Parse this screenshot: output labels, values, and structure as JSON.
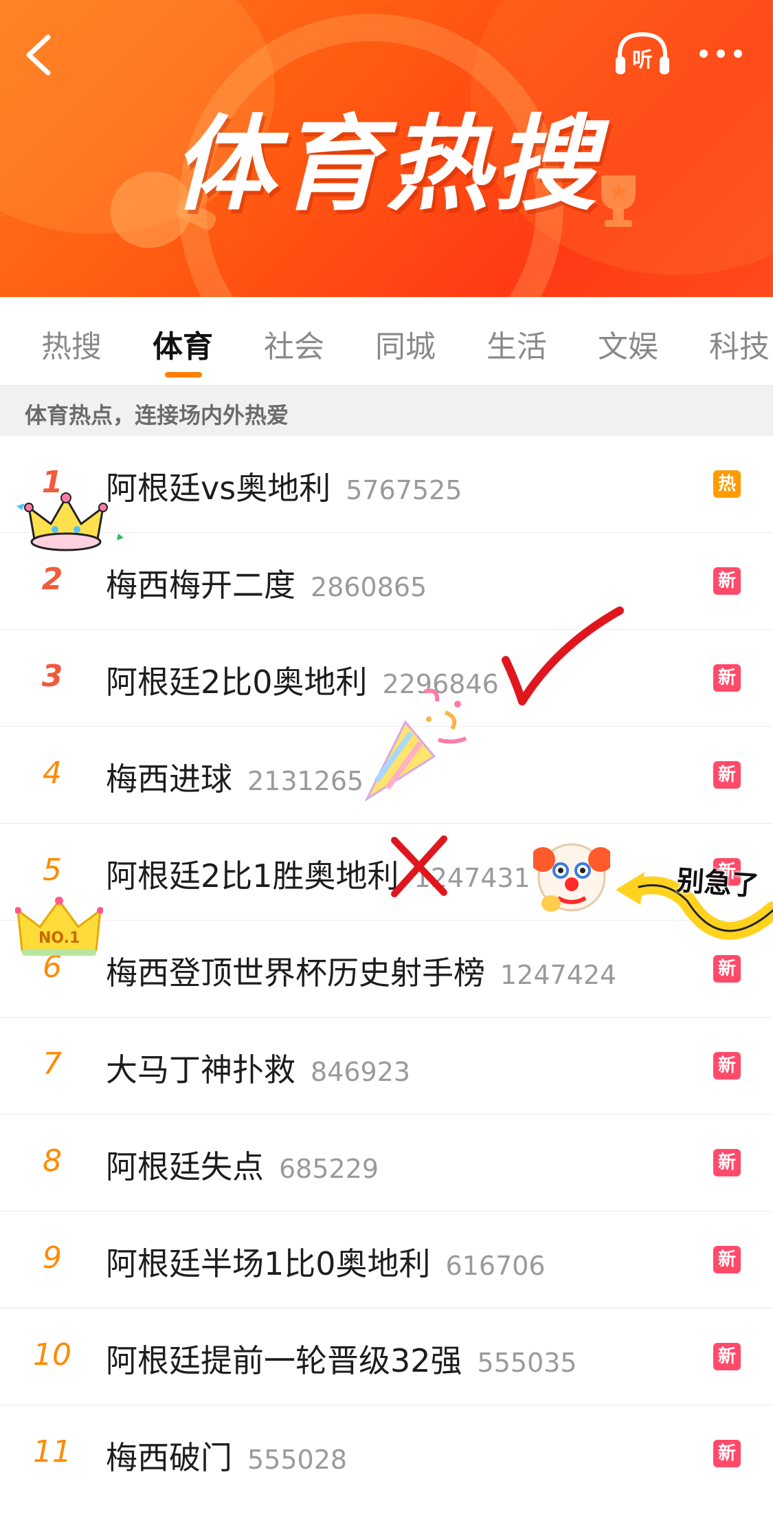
{
  "banner": {
    "title": "体育热搜",
    "listen_label": "听"
  },
  "tabs": [
    {
      "label": "热搜",
      "active": false
    },
    {
      "label": "体育",
      "active": true
    },
    {
      "label": "社会",
      "active": false
    },
    {
      "label": "同城",
      "active": false
    },
    {
      "label": "生活",
      "active": false
    },
    {
      "label": "文娱",
      "active": false
    },
    {
      "label": "科技",
      "active": false
    }
  ],
  "subheader": "体育热点，连接场内外热爱",
  "items": [
    {
      "rank": "1",
      "title": "阿根廷vs奥地利",
      "count": "5767525",
      "badge": "热"
    },
    {
      "rank": "2",
      "title": "梅西梅开二度",
      "count": "2860865",
      "badge": "新"
    },
    {
      "rank": "3",
      "title": "阿根廷2比0奥地利",
      "count": "2296846",
      "badge": "新"
    },
    {
      "rank": "4",
      "title": "梅西进球",
      "count": "2131265",
      "badge": "新"
    },
    {
      "rank": "5",
      "title": "阿根廷2比1胜奥地利",
      "count": "1247431",
      "badge": "新"
    },
    {
      "rank": "6",
      "title": "梅西登顶世界杯历史射手榜",
      "count": "1247424",
      "badge": "新"
    },
    {
      "rank": "7",
      "title": "大马丁神扑救",
      "count": "846923",
      "badge": "新"
    },
    {
      "rank": "8",
      "title": "阿根廷失点",
      "count": "685229",
      "badge": "新"
    },
    {
      "rank": "9",
      "title": "阿根廷半场1比0奥地利",
      "count": "616706",
      "badge": "新"
    },
    {
      "rank": "10",
      "title": "阿根廷提前一轮晋级32强",
      "count": "555035",
      "badge": "新"
    },
    {
      "rank": "11",
      "title": "梅西破门",
      "count": "555028",
      "badge": "新"
    }
  ],
  "stickers": {
    "crown_text": "NO.1",
    "handwritten_note": "别急了"
  },
  "colors": {
    "banner_orange": "#ff5a12",
    "tab_indicator": "#ff7e00",
    "rank_top": "#f25a3c",
    "rank_normal": "#ff8a00",
    "badge_hot": "#ff9a00",
    "badge_new": "#ff4a6a"
  },
  "icons": [
    "back-icon",
    "headphones-icon",
    "more-icon",
    "trophy-icon"
  ]
}
